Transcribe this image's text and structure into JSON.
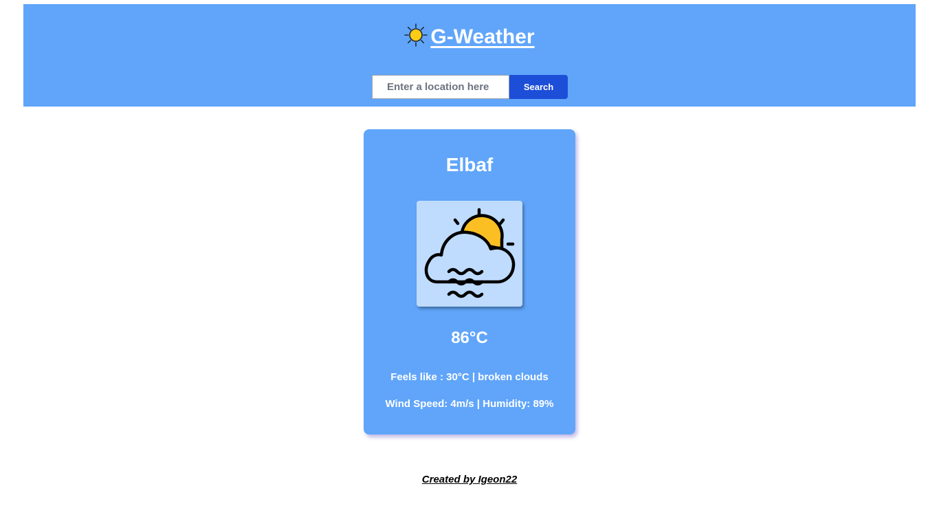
{
  "header": {
    "brand_icon": "sun-icon",
    "brand_title": "G-Weather",
    "background": "#60a5fa"
  },
  "search": {
    "placeholder": "Enter a location here",
    "value": "",
    "button_label": "Search",
    "button_color": "#1d4ed8"
  },
  "weather": {
    "city": "Elbaf",
    "icon": "partly-cloudy-fog-icon",
    "temperature": "86°C",
    "details_line_1": "Feels like : 30°C | broken clouds",
    "details_line_2": "Wind Speed: 4m/s | Humidity: 89%"
  },
  "footer": {
    "credit": "Created by Igeon22"
  }
}
